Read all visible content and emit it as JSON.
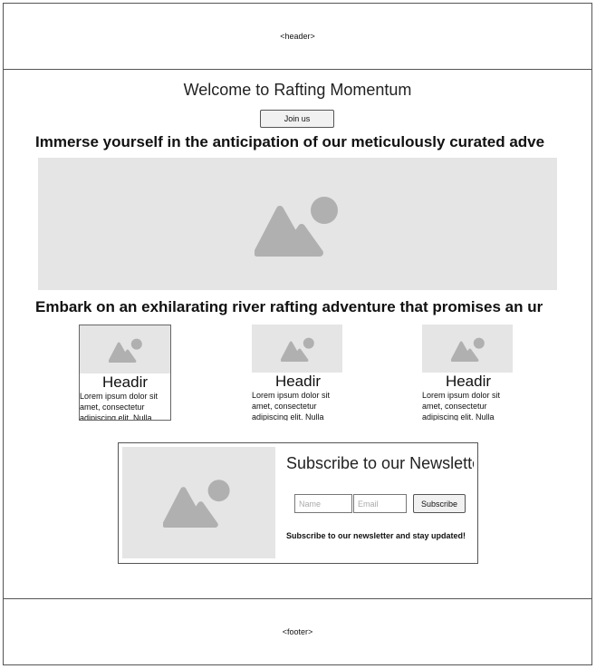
{
  "header": {
    "label": "<header>"
  },
  "footer": {
    "label": "<footer>"
  },
  "hero": {
    "welcome": "Welcome to Rafting Momentum",
    "join_label": "Join us",
    "headline": "Immerse yourself in the anticipation of our meticulously curated adve"
  },
  "section": {
    "headline": "Embark on an exhilarating river rafting adventure that promises an ur"
  },
  "cards": [
    {
      "title": "Headir",
      "body": "Lorem ipsum dolor sit amet, consectetur adipiscing elit. Nulla"
    },
    {
      "title": "Headir",
      "body": "Lorem ipsum dolor sit amet, consectetur adipiscing elit. Nulla"
    },
    {
      "title": "Headir",
      "body": "Lorem ipsum dolor sit amet, consectetur adipiscing elit. Nulla"
    }
  ],
  "newsletter": {
    "title": "Subscribe to our Newslette",
    "name_placeholder": "Name",
    "email_placeholder": "Email",
    "subscribe_label": "Subscribe",
    "note": "Subscribe to our newsletter and stay updated!"
  },
  "icons": {
    "image_placeholder": "image-placeholder-icon"
  },
  "colors": {
    "placeholder_bg": "#e5e5e5",
    "placeholder_icon": "#b0b0b0",
    "border": "#555555"
  }
}
